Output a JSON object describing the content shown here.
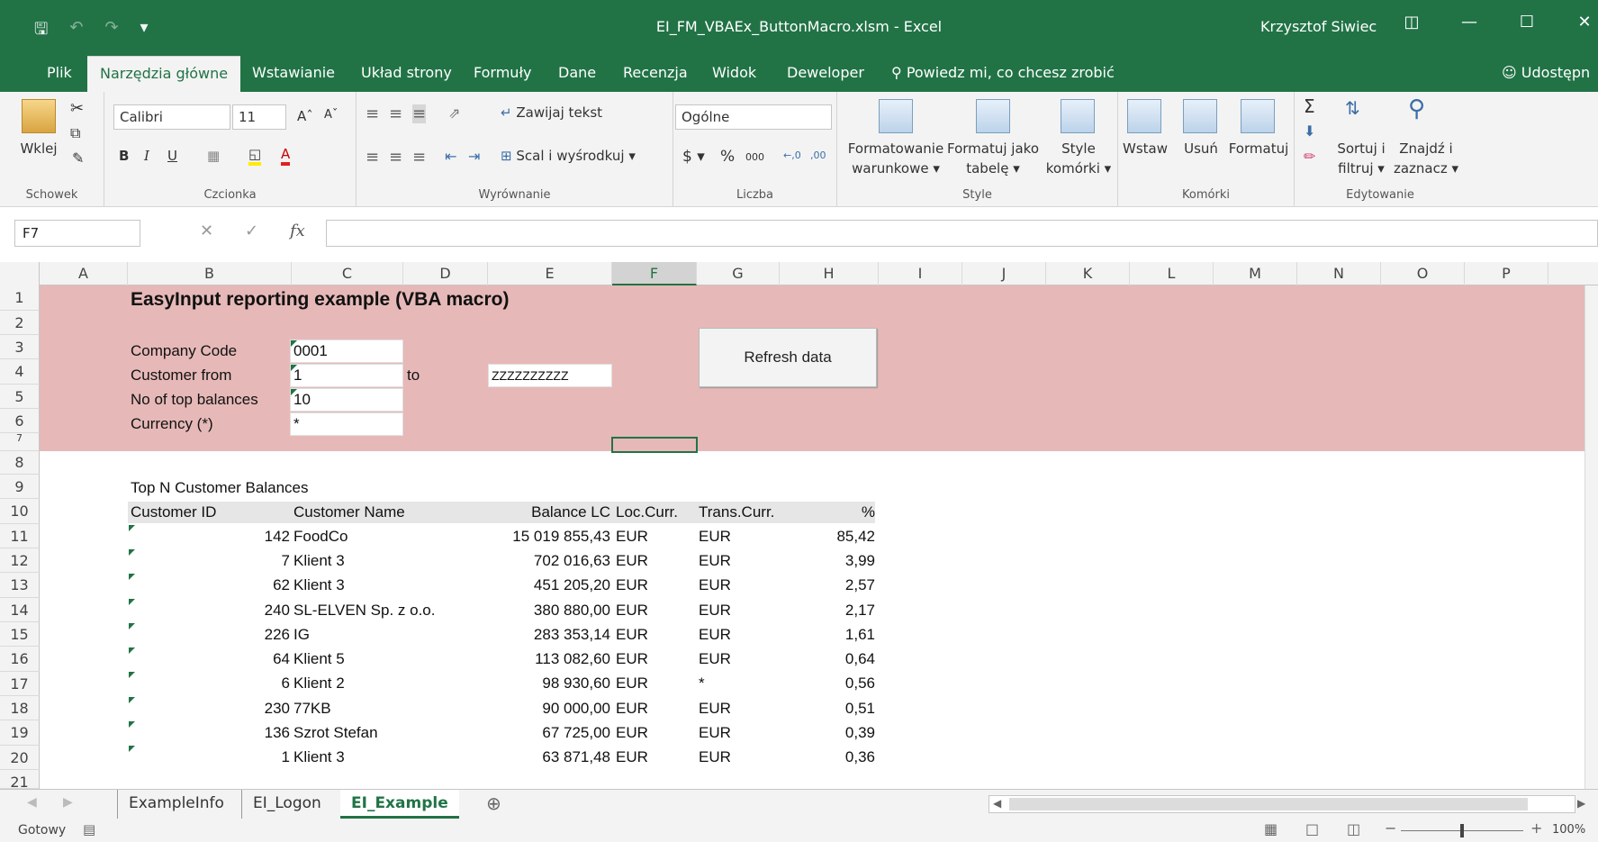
{
  "titlebar": {
    "title": "EI_FM_VBAEx_ButtonMacro.xlsm  -  Excel",
    "user": "Krzysztof Siwiec"
  },
  "tabs": [
    {
      "label": "Plik"
    },
    {
      "label": "Narzędzia główne"
    },
    {
      "label": "Wstawianie"
    },
    {
      "label": "Układ strony"
    },
    {
      "label": "Formuły"
    },
    {
      "label": "Dane"
    },
    {
      "label": "Recenzja"
    },
    {
      "label": "Widok"
    },
    {
      "label": "Deweloper"
    }
  ],
  "tell_me": "Powiedz mi, co chcesz zrobić",
  "share": "Udostępn",
  "ribbon": {
    "paste": "Wklej",
    "clipboard_group": "Schowek",
    "font_name": "Calibri",
    "font_size": "11",
    "font_group": "Czcionka",
    "wrap_text": "Zawijaj tekst",
    "merge_center": "Scal i wyśrodkuj",
    "alignment_group": "Wyrównanie",
    "number_format": "Ogólne",
    "number_group": "Liczba",
    "cond_format_1": "Formatowanie",
    "cond_format_2": "warunkowe",
    "format_table_1": "Formatuj jako",
    "format_table_2": "tabelę",
    "cell_styles_1": "Style",
    "cell_styles_2": "komórki",
    "styles_group": "Style",
    "insert": "Wstaw",
    "delete": "Usuń",
    "format": "Formatuj",
    "cells_group": "Komórki",
    "sort_1": "Sortuj i",
    "sort_2": "filtruj",
    "find_1": "Znajdź i",
    "find_2": "zaznacz",
    "editing_group": "Edytowanie"
  },
  "formula_bar": {
    "name_box": "F7",
    "fx": "fx",
    "value": ""
  },
  "columns": [
    "A",
    "B",
    "C",
    "D",
    "E",
    "F",
    "G",
    "H",
    "I",
    "J",
    "K",
    "L",
    "M",
    "N",
    "O",
    "P"
  ],
  "rows": [
    "1",
    "2",
    "3",
    "4",
    "5",
    "6",
    "7",
    "8",
    "9",
    "10",
    "11",
    "12",
    "13",
    "14",
    "15",
    "16",
    "17",
    "18",
    "19",
    "20",
    "21"
  ],
  "sheet": {
    "heading": "EasyInput reporting example (VBA macro)",
    "company_code_label": "Company Code",
    "company_code_value": "0001",
    "customer_from_label": "Customer from",
    "customer_from_value": "1",
    "to_label": "to",
    "customer_to_value": "ZZZZZZZZZZ",
    "top_label": "No of top balances",
    "top_value": "10",
    "currency_label": "Currency (*)",
    "currency_value": "*",
    "refresh_button": "Refresh data",
    "table_title": "Top N Customer Balances",
    "table_headers": [
      "Customer ID",
      "Customer Name",
      "Balance LC",
      "Loc.Curr.",
      "Trans.Curr.",
      "%"
    ],
    "table_rows": [
      {
        "id": "142",
        "name": "FoodCo",
        "balance": "15 019 855,43",
        "loc": "EUR",
        "trans": "EUR",
        "pct": "85,42"
      },
      {
        "id": "7",
        "name": "Klient 3",
        "balance": "702 016,63",
        "loc": "EUR",
        "trans": "EUR",
        "pct": "3,99"
      },
      {
        "id": "62",
        "name": "Klient 3",
        "balance": "451 205,20",
        "loc": "EUR",
        "trans": "EUR",
        "pct": "2,57"
      },
      {
        "id": "240",
        "name": "SL-ELVEN Sp. z o.o.",
        "balance": "380 880,00",
        "loc": "EUR",
        "trans": "EUR",
        "pct": "2,17"
      },
      {
        "id": "226",
        "name": "IG",
        "balance": "283 353,14",
        "loc": "EUR",
        "trans": "EUR",
        "pct": "1,61"
      },
      {
        "id": "64",
        "name": "Klient 5",
        "balance": "113 082,60",
        "loc": "EUR",
        "trans": "EUR",
        "pct": "0,64"
      },
      {
        "id": "6",
        "name": "Klient 2",
        "balance": "98 930,60",
        "loc": "EUR",
        "trans": "*",
        "pct": "0,56"
      },
      {
        "id": "230",
        "name": "77KB",
        "balance": "90 000,00",
        "loc": "EUR",
        "trans": "EUR",
        "pct": "0,51"
      },
      {
        "id": "136",
        "name": "Szrot Stefan",
        "balance": "67 725,00",
        "loc": "EUR",
        "trans": "EUR",
        "pct": "0,39"
      },
      {
        "id": "1",
        "name": "Klient 3",
        "balance": "63 871,48",
        "loc": "EUR",
        "trans": "EUR",
        "pct": "0,36"
      }
    ]
  },
  "sheet_tabs": [
    {
      "label": "ExampleInfo"
    },
    {
      "label": "EI_Logon"
    },
    {
      "label": "EI_Example"
    }
  ],
  "status": {
    "ready": "Gotowy",
    "zoom": "100%"
  },
  "colors": {
    "excel_green": "#217346",
    "input_area": "#e6b9b8"
  }
}
